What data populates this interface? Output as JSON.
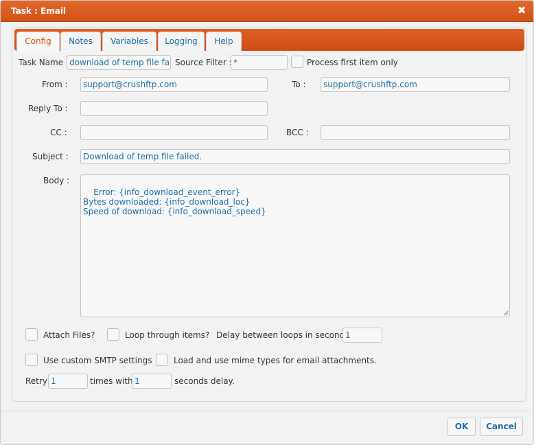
{
  "window": {
    "title": "Task : Email",
    "close_icon": "close-icon"
  },
  "tabs": [
    {
      "label": "Config",
      "active": true
    },
    {
      "label": "Notes"
    },
    {
      "label": "Variables"
    },
    {
      "label": "Logging"
    },
    {
      "label": "Help"
    }
  ],
  "form": {
    "task_name_label": "Task Name :",
    "task_name_value": "download of temp file fail",
    "source_filter_label": "Source Filter :",
    "source_filter_value": "*",
    "process_first_label": "Process first item only",
    "from_label": "From :",
    "from_value": "support@crushftp.com",
    "to_label": "To :",
    "to_value": "support@crushftp.com",
    "reply_to_label": "Reply To :",
    "reply_to_value": "",
    "cc_label": "CC :",
    "cc_value": "",
    "bcc_label": "BCC :",
    "bcc_value": "",
    "subject_label": "Subject :",
    "subject_value": "Download of temp file failed.",
    "body_label": "Body :",
    "body_value": "Error: {info_download_event_error}\nBytes downloaded: {info_download_loc}\nSpeed of download: {info_download_speed}",
    "attach_files_label": "Attach Files?",
    "loop_items_label": "Loop through items?",
    "delay_label": "Delay between loops in seconds :",
    "delay_value": "1",
    "custom_smtp_label": "Use custom SMTP settings",
    "mime_types_label": "Load and use mime types for email attachments.",
    "retry_label": "Retry",
    "retry_value": "1",
    "times_with_label": "times with",
    "seconds_value": "1",
    "seconds_delay_label": "seconds delay."
  },
  "buttons": {
    "ok": "OK",
    "cancel": "Cancel"
  },
  "colors": {
    "accent": "#d2521a",
    "value_text": "#1f6fa8"
  }
}
